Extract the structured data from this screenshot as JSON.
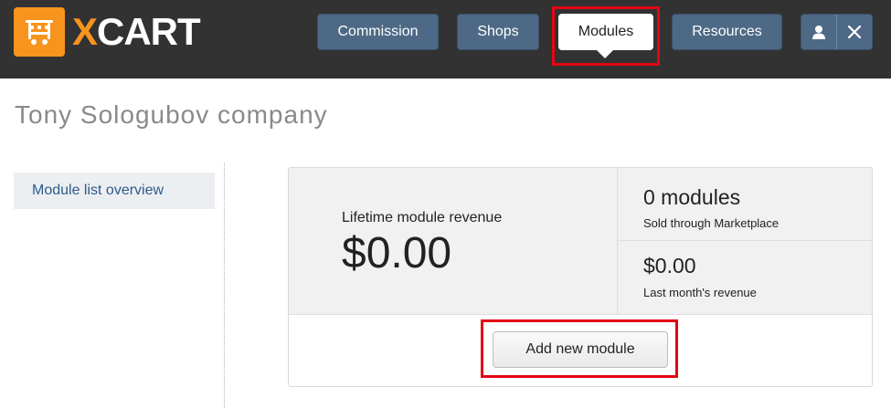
{
  "header": {
    "logo": {
      "x": "X",
      "rest": "CART"
    },
    "nav": [
      {
        "label": "Commission",
        "active": false
      },
      {
        "label": "Shops",
        "active": false
      },
      {
        "label": "Modules",
        "active": true
      },
      {
        "label": "Resources",
        "active": false
      }
    ],
    "user_icon": "user-icon",
    "close_icon": "close-icon"
  },
  "page": {
    "title": "Tony Sologubov company"
  },
  "sidebar": {
    "items": [
      {
        "label": "Module list overview"
      }
    ]
  },
  "stats": {
    "lifetime_label": "Lifetime module revenue",
    "lifetime_value": "$0.00",
    "modules_value": "0 modules",
    "modules_sub": "Sold through Marketplace",
    "month_value": "$0.00",
    "month_sub": "Last month's revenue"
  },
  "actions": {
    "add_module_label": "Add new module"
  },
  "colors": {
    "brand_orange": "#f7941d",
    "nav_blue": "#4d6985",
    "highlight_red": "#e30613",
    "header_bg": "#323232"
  }
}
